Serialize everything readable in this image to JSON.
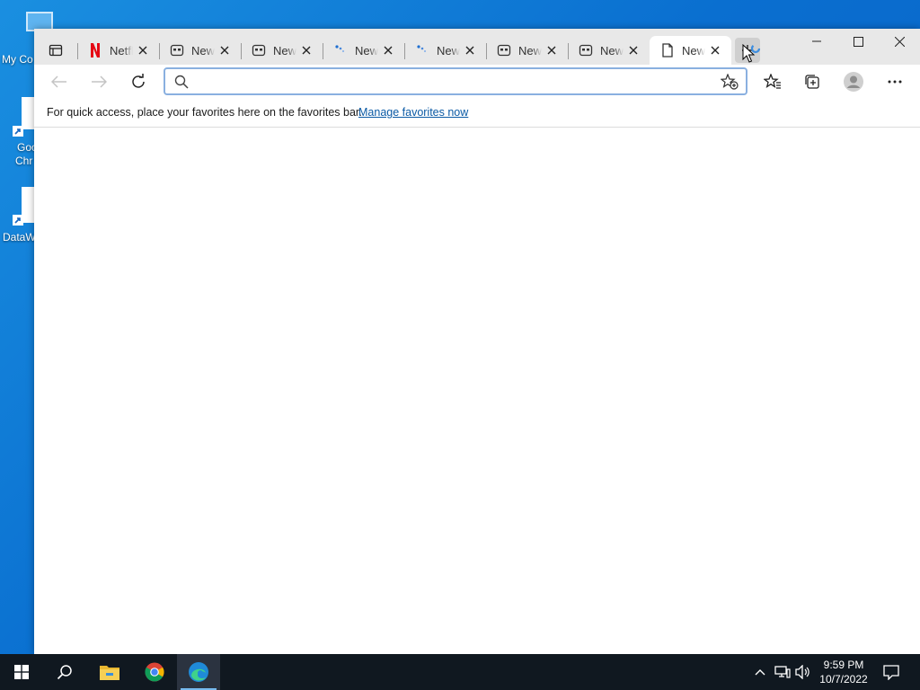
{
  "desktop": {
    "icons": [
      {
        "label": "My Co"
      },
      {
        "label": "Goo",
        "label2": "Chr"
      },
      {
        "label": "DataW"
      }
    ]
  },
  "browser": {
    "tabs": [
      {
        "title": "Netfl",
        "favicon": "netflix-icon",
        "active": false
      },
      {
        "title": "New",
        "favicon": "newtab-grid-icon",
        "active": false
      },
      {
        "title": "New",
        "favicon": "newtab-grid-icon",
        "active": false
      },
      {
        "title": "New",
        "favicon": "loading-dots-icon",
        "active": false
      },
      {
        "title": "New",
        "favicon": "loading-dots-icon",
        "active": false
      },
      {
        "title": "New",
        "favicon": "newtab-grid-icon",
        "active": false
      },
      {
        "title": "New",
        "favicon": "newtab-grid-icon",
        "active": false
      },
      {
        "title": "New",
        "favicon": "page-icon",
        "active": true
      }
    ],
    "address": {
      "value": "",
      "placeholder": ""
    },
    "favorites_bar": {
      "message": "For quick access, place your favorites here on the favorites bar.",
      "link": "Manage favorites now"
    }
  },
  "taskbar": {
    "apps": [
      "start-icon",
      "search-icon",
      "file-explorer-icon",
      "chrome-icon",
      "edge-icon"
    ],
    "clock": {
      "time": "9:59 PM",
      "date": "10/7/2022"
    }
  },
  "colors": {
    "accent": "#0b5aa5",
    "taskbar": "#101820",
    "desktop": "#0a6fd0"
  }
}
